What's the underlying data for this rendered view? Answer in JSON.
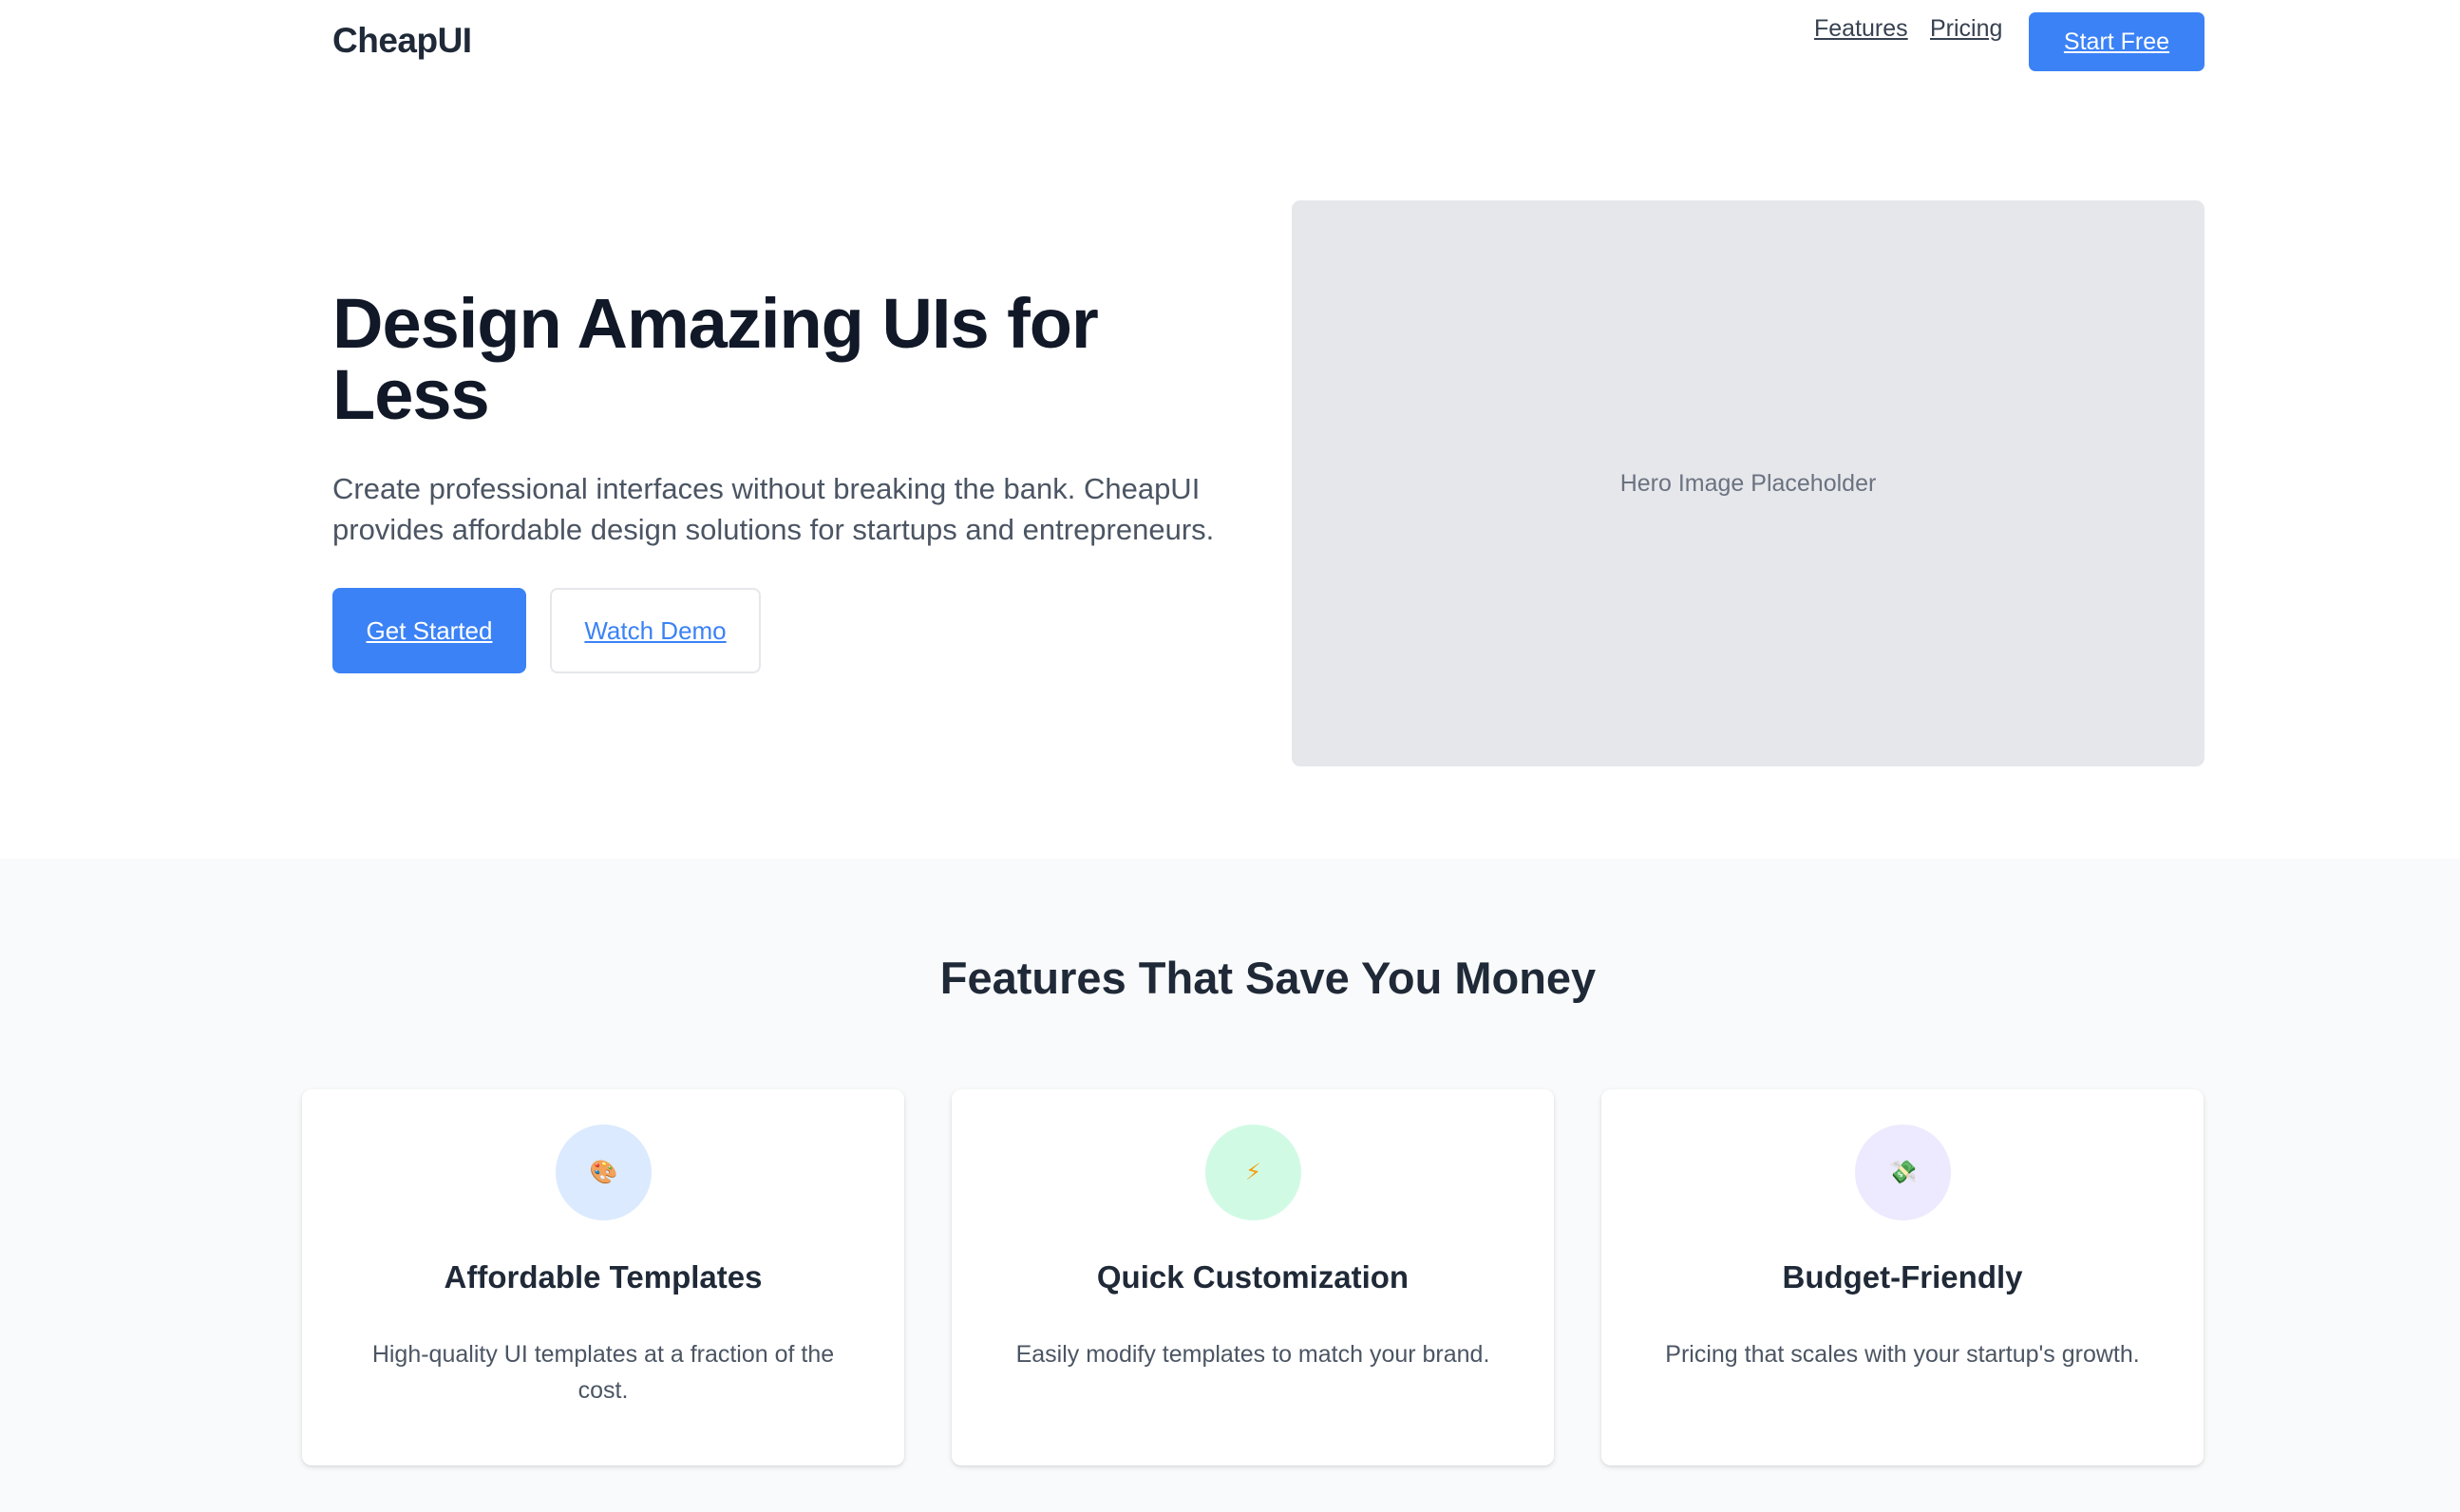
{
  "header": {
    "logo": "CheapUI",
    "nav": {
      "features": "Features",
      "pricing": "Pricing"
    },
    "cta": "Start Free"
  },
  "hero": {
    "title": "Design Amazing UIs for Less",
    "description": "Create professional interfaces without breaking the bank. CheapUI provides affordable design solutions for startups and entrepreneurs.",
    "primary_button": "Get Started",
    "secondary_button": "Watch Demo",
    "image_placeholder": "Hero Image Placeholder"
  },
  "features": {
    "title": "Features That Save You Money",
    "cards": [
      {
        "icon": "palette-icon",
        "icon_glyph": "🎨",
        "title": "Affordable Templates",
        "description": "High-quality UI templates at a fraction of the cost."
      },
      {
        "icon": "lightning-icon",
        "icon_glyph": "⚡",
        "title": "Quick Customization",
        "description": "Easily modify templates to match your brand."
      },
      {
        "icon": "money-icon",
        "icon_glyph": "💸",
        "title": "Budget-Friendly",
        "description": "Pricing that scales with your startup's growth."
      }
    ]
  },
  "colors": {
    "accent": "#3b82f6",
    "section_bg": "#f9fafb",
    "placeholder_bg": "#e5e7eb"
  }
}
